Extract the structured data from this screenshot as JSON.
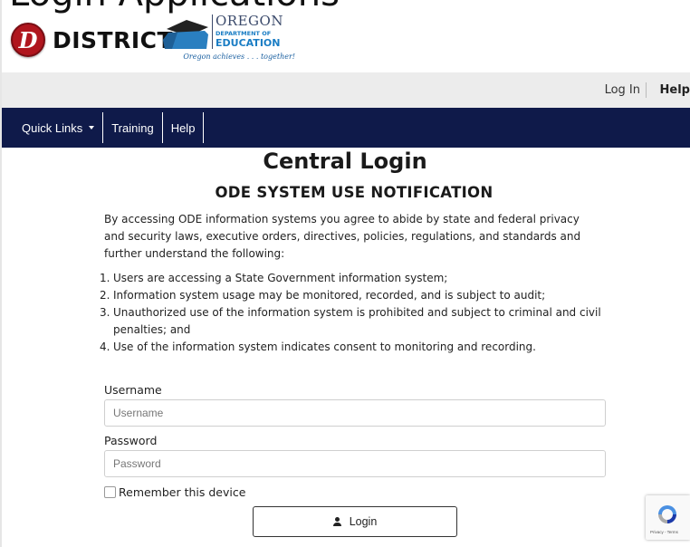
{
  "top_clip": "Login Applications",
  "header": {
    "district_initial": "D",
    "district_name": "DISTRICT",
    "oregon_word": "OREGON",
    "ode_department": "DEPARTMENT OF",
    "ode_education": "EDUCATION",
    "ode_tagline": "Oregon achieves . . . together!"
  },
  "utility": {
    "login_label": "Log In",
    "help_label": "Help"
  },
  "nav": {
    "quick_links": "Quick Links",
    "training": "Training",
    "help": "Help"
  },
  "main": {
    "title": "Central Login",
    "notice_title": "ODE SYSTEM USE NOTIFICATION",
    "intro": "By accessing ODE information systems you agree to abide by state and federal privacy and security laws, executive orders, directives, policies, regulations, and standards and further understand the following:",
    "items": [
      {
        "num": "1.",
        "text": "Users are accessing a State Government information system;"
      },
      {
        "num": "2.",
        "text": "Information system usage may be monitored, recorded, and is subject to audit;"
      },
      {
        "num": "3.",
        "text": "Unauthorized use of the information system is prohibited and subject to criminal and civil penalties; and"
      },
      {
        "num": "4.",
        "text": "Use of the information system indicates consent to monitoring and recording."
      }
    ]
  },
  "form": {
    "username_label": "Username",
    "username_placeholder": "Username",
    "username_value": "",
    "password_label": "Password",
    "password_placeholder": "Password",
    "password_value": "",
    "remember_label": "Remember this device",
    "remember_checked": false,
    "login_label": "Login"
  },
  "recaptcha": {
    "text": "Privacy - Terms"
  },
  "colors": {
    "nav_background": "#0f1a4a",
    "utility_background": "#ececec",
    "district_red": "#b0161e",
    "ode_blue": "#1a7dc4"
  }
}
